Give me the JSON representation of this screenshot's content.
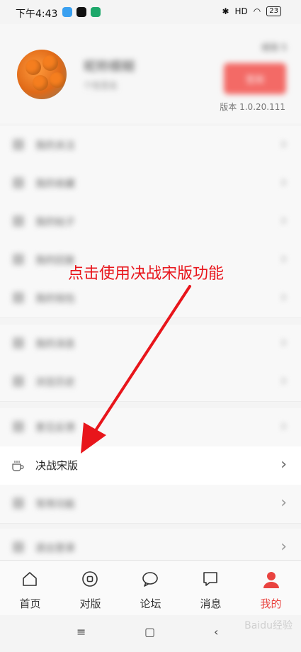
{
  "status_bar": {
    "time": "下午4:43",
    "battery": "23",
    "signal_label": "HD"
  },
  "profile": {
    "username": "昵称模糊",
    "subtitle": "个性签名",
    "experience": "经验 5",
    "sign_button": "签到",
    "version": "版本 1.0.20.111"
  },
  "menu": {
    "blurred_items": [
      "我的关注",
      "我的收藏",
      "我的帖子",
      "我的回复",
      "我的钱包",
      "我的消息",
      "浏览历史",
      "意见反馈"
    ],
    "focus_item": "决战宋版",
    "after_items": [
      "常用功能",
      "退出登录"
    ]
  },
  "annotation": {
    "text": "点击使用决战宋版功能",
    "color": "#e8151b"
  },
  "tabbar": {
    "tabs": [
      {
        "label": "首页",
        "icon": "home-icon"
      },
      {
        "label": "对版",
        "icon": "compare-icon"
      },
      {
        "label": "论坛",
        "icon": "forum-icon"
      },
      {
        "label": "消息",
        "icon": "message-icon"
      },
      {
        "label": "我的",
        "icon": "profile-icon"
      }
    ],
    "active_index": 4,
    "active_color": "#e9433f"
  },
  "watermark": "Baidu经验"
}
